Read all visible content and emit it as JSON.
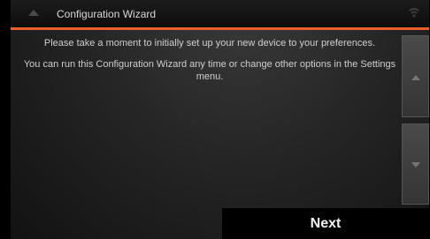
{
  "window": {
    "title": "Configuration Wizard"
  },
  "content": {
    "paragraph1": "Please take a moment to initially set up your new device to your preferences.",
    "paragraph2": "You can run this Configuration Wizard any time or change other options in the Settings menu."
  },
  "footer": {
    "next_label": "Next"
  },
  "colors": {
    "accent": "#e8612c",
    "background": "#262626",
    "button": "#000000"
  },
  "icons": {
    "title_left": "chevron-up-icon",
    "title_right": "signal-icon",
    "scroll_up": "arrow-up-icon",
    "scroll_down": "arrow-down-icon"
  }
}
